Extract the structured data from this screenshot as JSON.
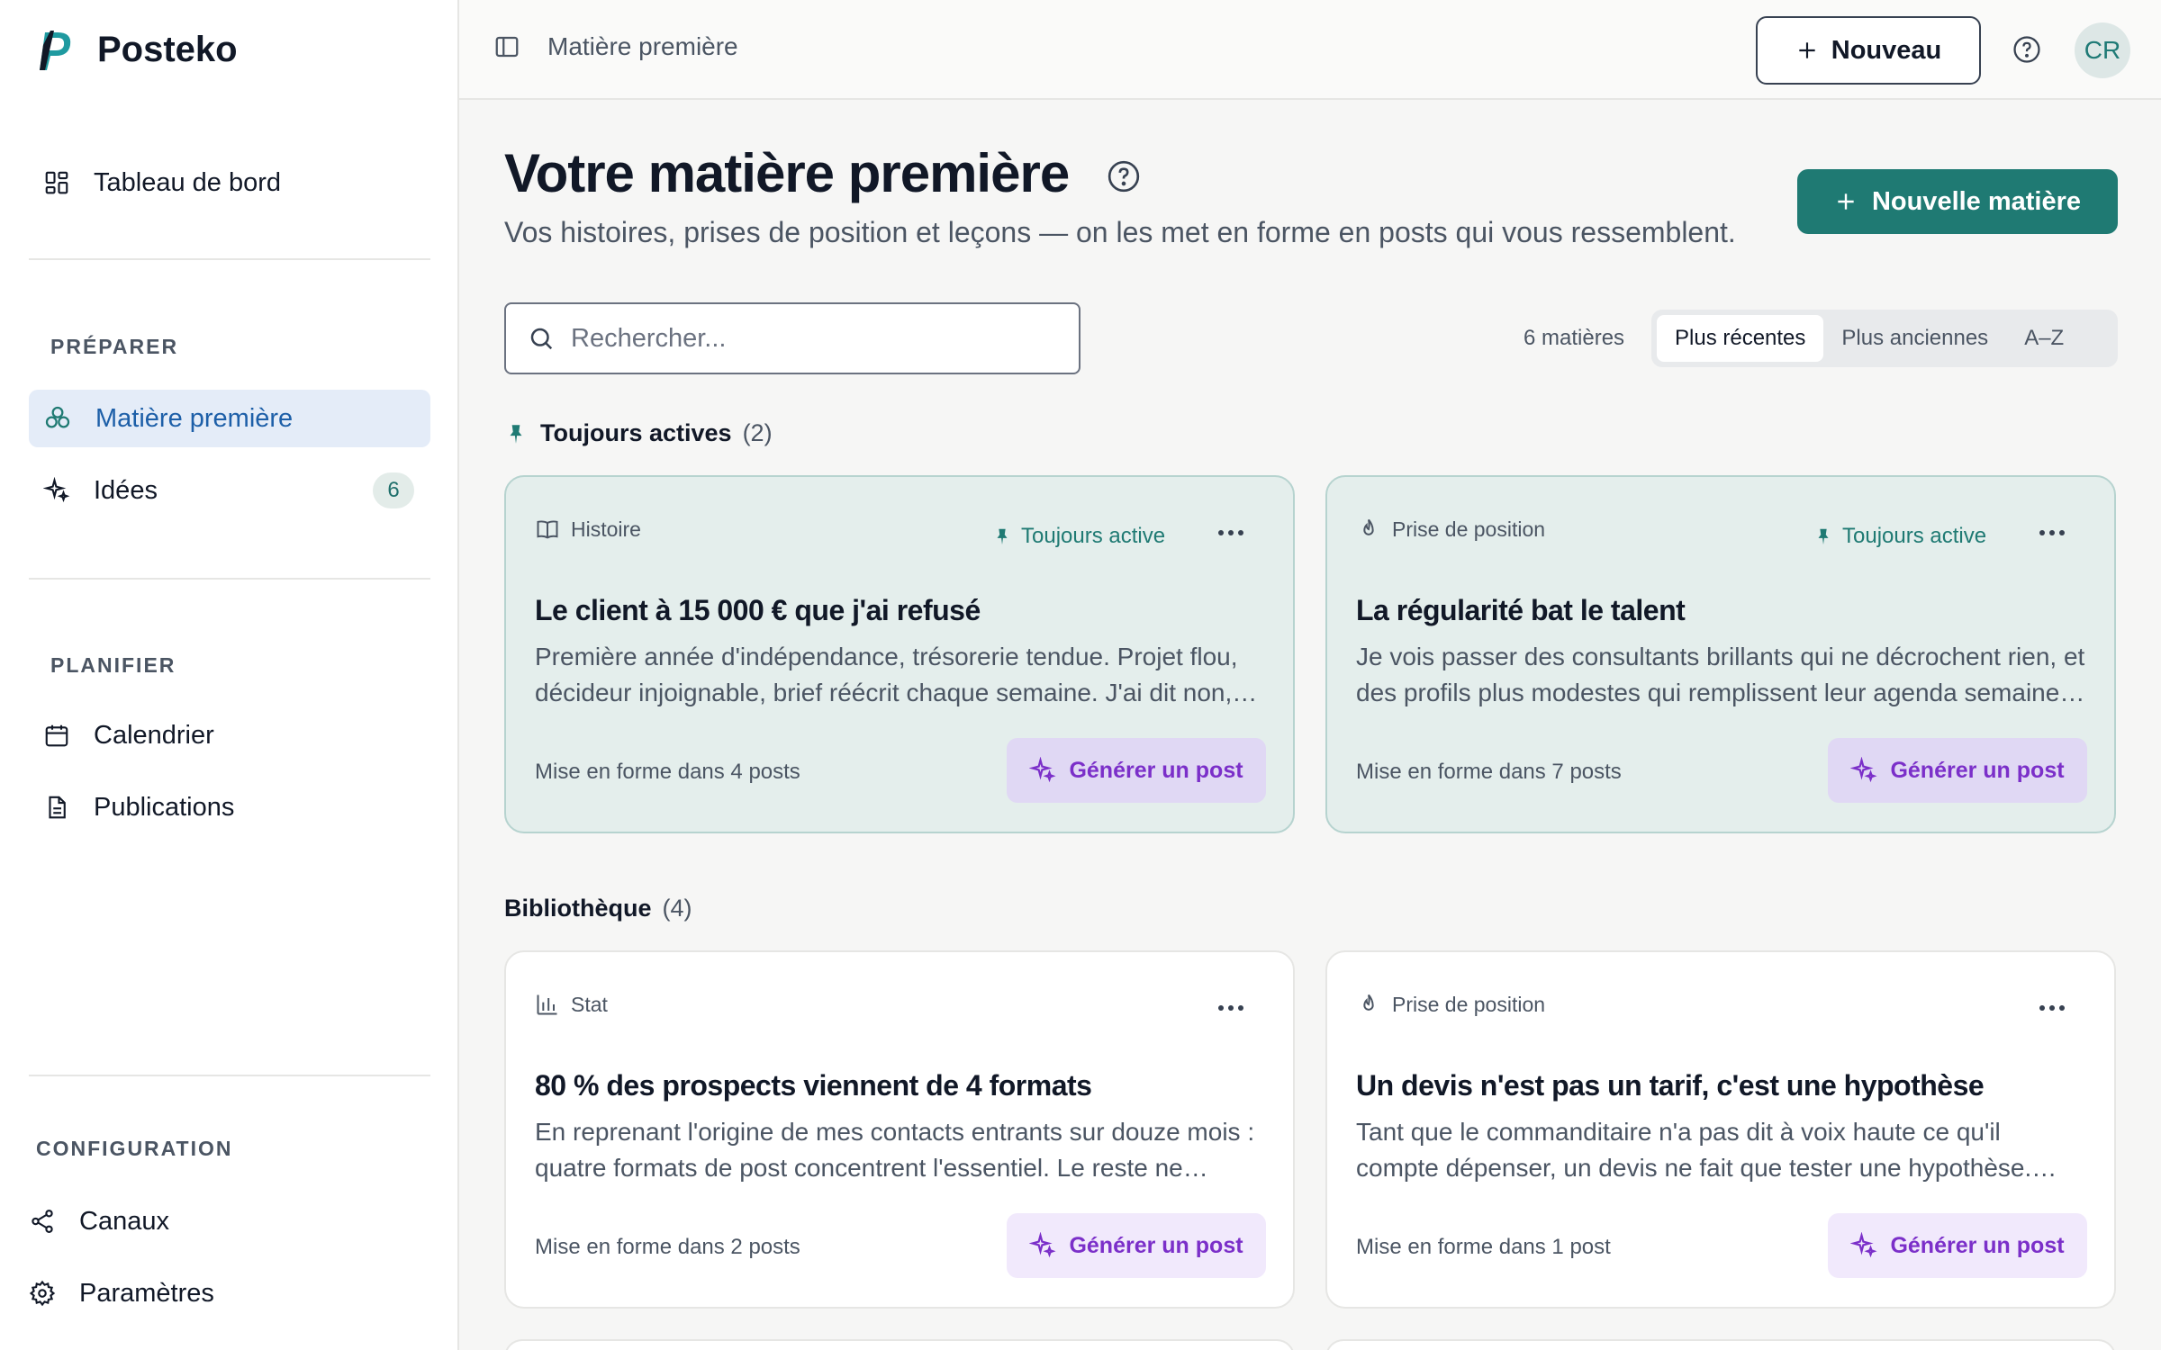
{
  "app": {
    "name": "Posteko"
  },
  "header": {
    "breadcrumb": "Matière première",
    "new_button": "Nouveau",
    "avatar_initials": "CR"
  },
  "sidebar": {
    "dashboard": "Tableau de bord",
    "sections": {
      "prepare": "PRÉPARER",
      "plan": "PLANIFIER",
      "config": "CONFIGURATION"
    },
    "items": {
      "raw_material": "Matière première",
      "ideas": "Idées",
      "ideas_count": "6",
      "calendar": "Calendrier",
      "publications": "Publications",
      "channels": "Canaux",
      "settings": "Paramètres"
    }
  },
  "main": {
    "title": "Votre matière première",
    "subtitle": "Vos histoires, prises de position et leçons — on les met en forme en posts qui vous ressemblent.",
    "primary_button": "Nouvelle matière",
    "search_placeholder": "Rechercher...",
    "count": "6 matières",
    "sort_options": [
      "Plus récentes",
      "Plus anciennes",
      "A–Z"
    ],
    "sort_selected": "Plus récentes"
  },
  "groups": {
    "pinned": {
      "label": "Toujours actives",
      "count": "(2)",
      "cards": [
        {
          "type": "Histoire",
          "pinned_label": "Toujours active",
          "title": "Le client à 15 000 € que j'ai refusé",
          "description": "Première année d'indépendance, trésorerie tendue. Projet flou, décideur injoignable, brief réécrit chaque semaine. J'ai dit non, et ce refus m'a appris à choisir mes clients.",
          "footer": "Mise en forme dans 4 posts",
          "action": "Générer un post"
        },
        {
          "type": "Prise de position",
          "pinned_label": "Toujours active",
          "title": "La régularité bat le talent",
          "description": "Je vois passer des consultants brillants qui ne décrochent rien, et des profils plus modestes qui remplissent leur agenda semaine après semaine.",
          "footer": "Mise en forme dans 7 posts",
          "action": "Générer un post"
        }
      ]
    },
    "library": {
      "label": "Bibliothèque",
      "count": "(4)",
      "cards": [
        {
          "type": "Stat",
          "title": "80 % des prospects viennent de 4 formats",
          "description": "En reprenant l'origine de mes contacts entrants sur douze mois : quatre formats de post concentrent l'essentiel. Le reste ne génère presque rien.",
          "footer": "Mise en forme dans 2 posts",
          "action": "Générer un post"
        },
        {
          "type": "Prise de position",
          "title": "Un devis n'est pas un tarif, c'est une hypothèse",
          "description": "Tant que le commanditaire n'a pas dit à voix haute ce qu'il compte dépenser, un devis ne fait que tester une hypothèse. Parlez budget d'abord.",
          "footer": "Mise en forme dans 1 post",
          "action": "Générer un post"
        }
      ]
    }
  },
  "colors": {
    "accent": "#1f7a73",
    "generate": "#7b2fc9",
    "active_nav": "#1d5fa8"
  }
}
